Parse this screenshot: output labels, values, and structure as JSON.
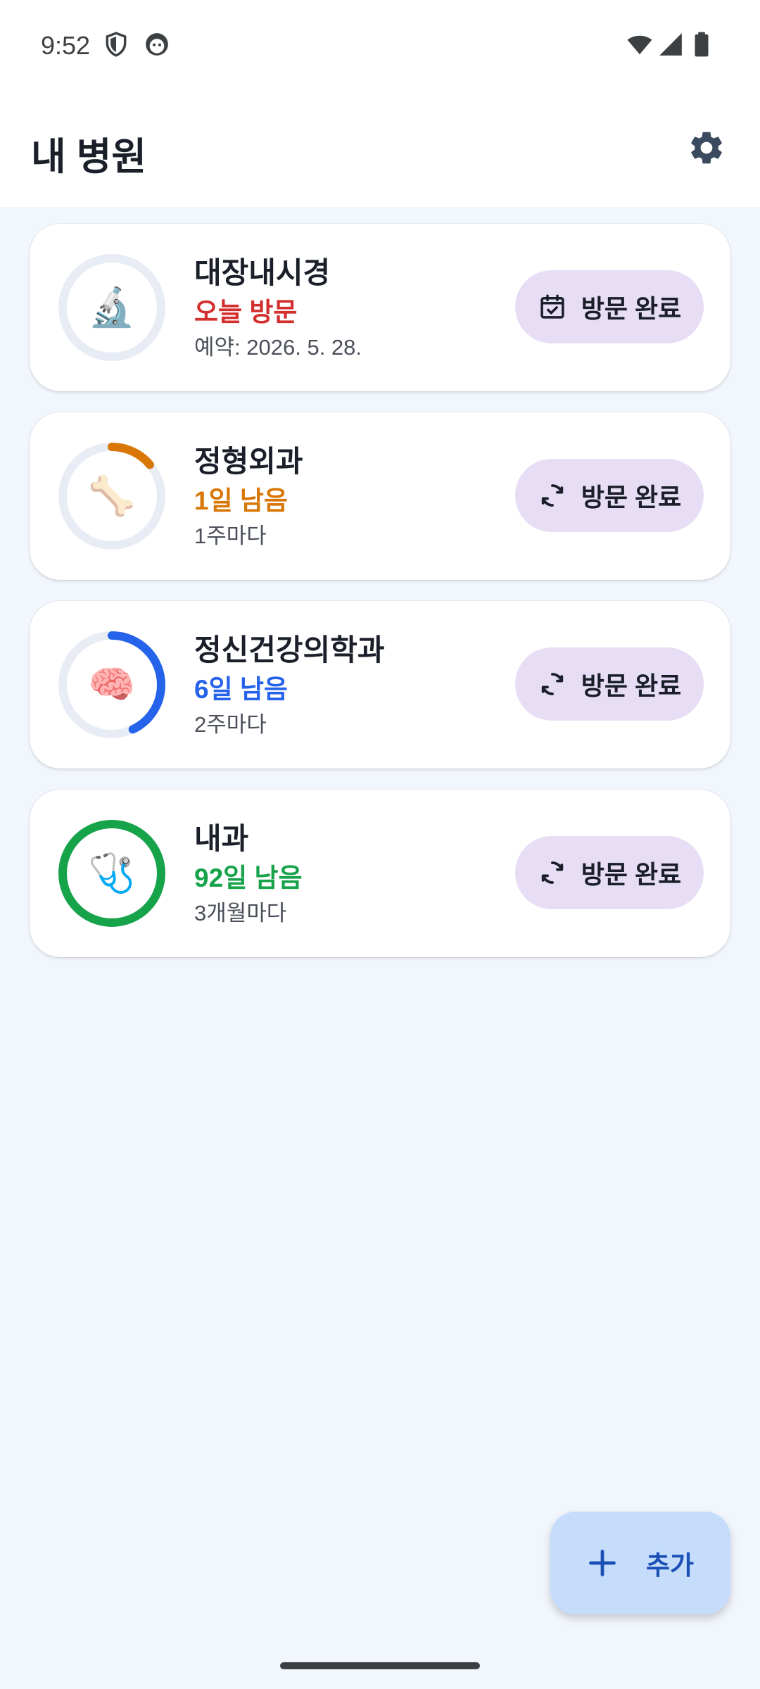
{
  "status_bar": {
    "time": "9:52",
    "icons": [
      "shield-icon",
      "face-icon",
      "wifi-icon",
      "cell-signal-icon",
      "battery-icon"
    ]
  },
  "header": {
    "title": "내 병원",
    "settings_icon": "gear-icon"
  },
  "hospitals": [
    {
      "name": "대장내시경",
      "status": "오늘 방문",
      "status_color": "#d32f2f",
      "detail": "예약: 2026. 5. 28.",
      "emoji": "🔬",
      "progress": 0,
      "progress_color": "#e8ecf4",
      "button_label": "방문 완료",
      "button_icon": "calendar-check-icon"
    },
    {
      "name": "정형외과",
      "status": "1일 남음",
      "status_color": "#d97706",
      "detail": "1주마다",
      "emoji": "🦴",
      "progress": 0.14,
      "progress_color": "#d97706",
      "button_label": "방문 완료",
      "button_icon": "refresh-icon"
    },
    {
      "name": "정신건강의학과",
      "status": "6일 남음",
      "status_color": "#2563eb",
      "detail": "2주마다",
      "emoji": "🧠",
      "progress": 0.43,
      "progress_color": "#2563eb",
      "button_label": "방문 완료",
      "button_icon": "refresh-icon"
    },
    {
      "name": "내과",
      "status": "92일 남음",
      "status_color": "#16a34a",
      "detail": "3개월마다",
      "emoji": "🩺",
      "progress": 1.0,
      "progress_color": "#16a34a",
      "button_label": "방문 완료",
      "button_icon": "refresh-icon"
    }
  ],
  "fab": {
    "label": "추가",
    "icon": "plus-icon"
  }
}
